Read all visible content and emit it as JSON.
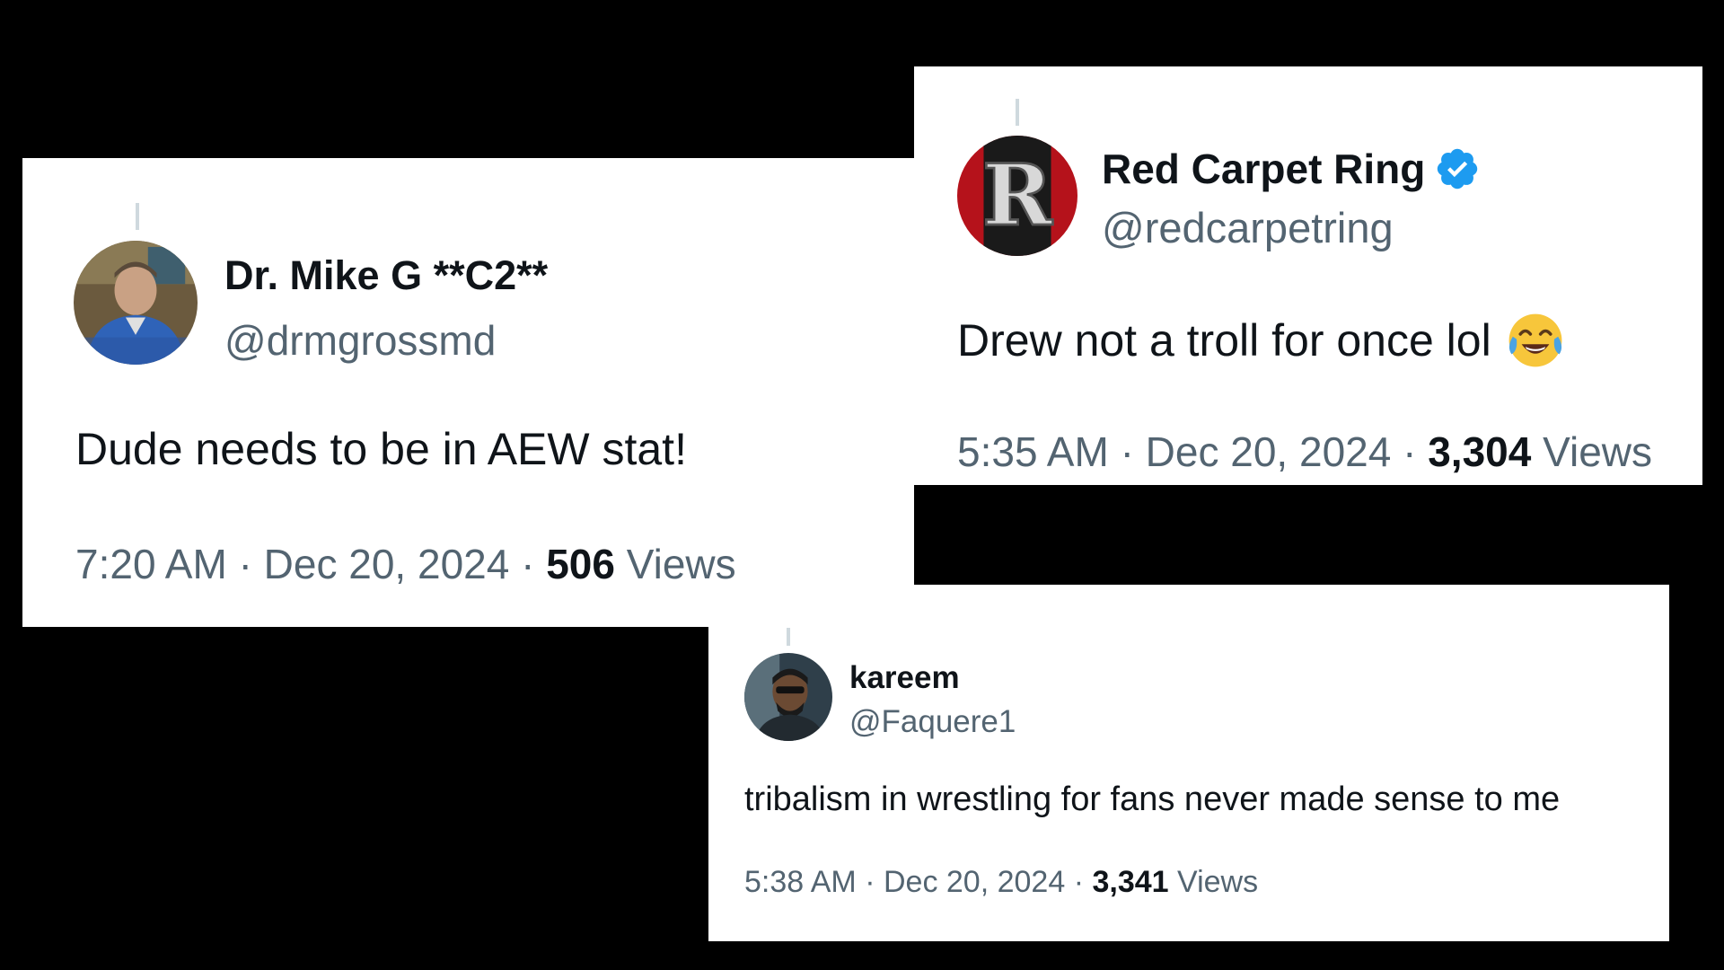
{
  "colors": {
    "background": "#000000",
    "card": "#ffffff",
    "text_primary": "#0f1419",
    "text_secondary": "#536471",
    "verified_blue": "#1d9bf0"
  },
  "tweets": [
    {
      "display_name": "Dr. Mike G **C2**",
      "handle": "@drmgrossmd",
      "text": "Dude needs to be in AEW stat!",
      "time": "7:20 AM",
      "sep1": "·",
      "date": "Dec 20, 2024",
      "sep2": "·",
      "views_count": "506",
      "views_label": "Views",
      "verified": false
    },
    {
      "display_name": "Red Carpet Ring",
      "handle": "@redcarpetring",
      "text": "Drew not a troll for once lol",
      "emoji": "tears-of-joy-emoji",
      "time": "5:35 AM",
      "sep1": "·",
      "date": "Dec 20, 2024",
      "sep2": "·",
      "views_count": "3,304",
      "views_label": "Views",
      "verified": true
    },
    {
      "display_name": "kareem",
      "handle": "@Faquere1",
      "text": "tribalism in wrestling for fans never made sense to me",
      "time": "5:38 AM",
      "sep1": "·",
      "date": "Dec 20, 2024",
      "sep2": "·",
      "views_count": "3,341",
      "views_label": "Views",
      "verified": false
    }
  ]
}
